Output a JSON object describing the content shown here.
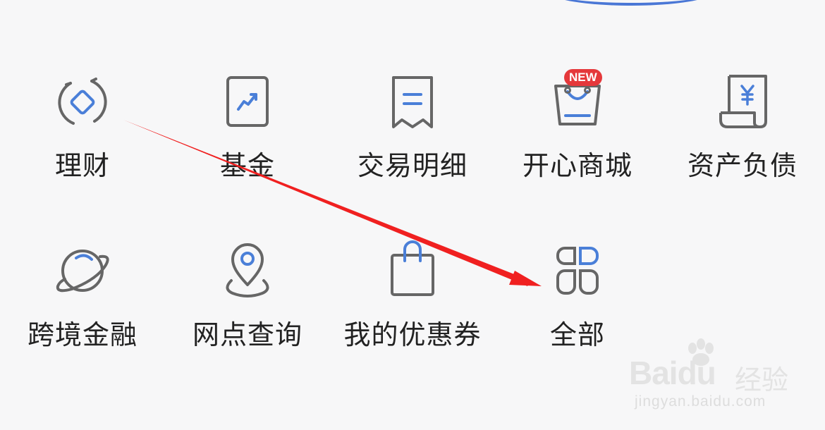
{
  "menu": {
    "items": [
      {
        "label": "理财",
        "icon": "wealth-icon"
      },
      {
        "label": "基金",
        "icon": "fund-icon"
      },
      {
        "label": "交易明细",
        "icon": "transaction-detail-icon"
      },
      {
        "label": "开心商城",
        "icon": "mall-bag-icon",
        "badge": "NEW"
      },
      {
        "label": "资产负债",
        "icon": "assets-receipt-icon"
      },
      {
        "label": "跨境金融",
        "icon": "planet-icon"
      },
      {
        "label": "网点查询",
        "icon": "location-pin-icon"
      },
      {
        "label": "我的优惠券",
        "icon": "shopping-bag-icon"
      },
      {
        "label": "全部",
        "icon": "all-grid-icon"
      }
    ]
  },
  "watermark": {
    "logo": "Baidu",
    "product": "经验",
    "url": "jingyan.baidu.com"
  },
  "colors": {
    "icon_stroke": "#666666",
    "icon_accent": "#4a7fd8",
    "badge": "#e5383b",
    "annotation_arrow": "#f02020",
    "background": "#f7f7f8"
  }
}
